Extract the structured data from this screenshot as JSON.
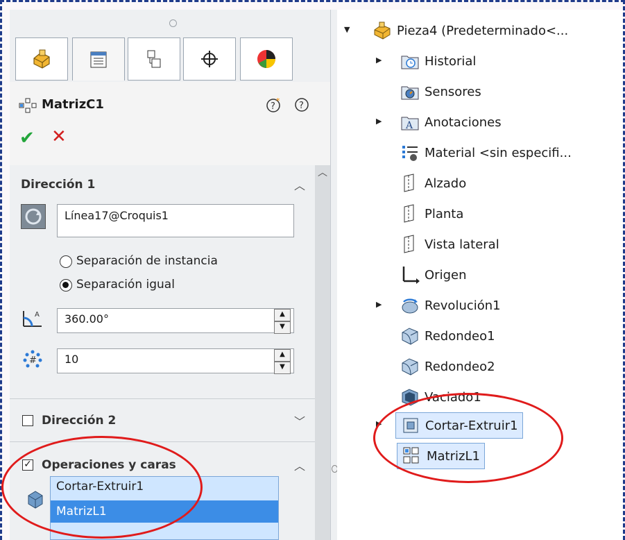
{
  "property_manager": {
    "tabs": [
      "feature-manager",
      "property-manager",
      "configuration-manager",
      "dimxpert-manager",
      "display-manager"
    ],
    "title": "MatrizC1",
    "direction1": {
      "title": "Dirección 1",
      "axis_value": "Línea17@Croquis1",
      "radio_options": [
        "Separación de instancia",
        "Separación igual"
      ],
      "selected_option": "Separación igual",
      "angle": "360.00°",
      "instances": "10"
    },
    "direction2": {
      "title": "Dirección 2",
      "checked": false
    },
    "features": {
      "title": "Operaciones y caras",
      "checked": true,
      "items": [
        "Cortar-Extruir1",
        "MatrizL1"
      ],
      "selected": "MatrizL1"
    }
  },
  "tree": {
    "root": "Pieza4  (Predeterminado<...",
    "items": [
      {
        "label": "Historial",
        "icon": "history-folder-icon",
        "expand": true
      },
      {
        "label": "Sensores",
        "icon": "sensors-folder-icon",
        "expand": false
      },
      {
        "label": "Anotaciones",
        "icon": "annotations-folder-icon",
        "expand": true
      },
      {
        "label": "Material <sin especifi...",
        "icon": "material-icon",
        "expand": false
      },
      {
        "label": "Alzado",
        "icon": "plane-icon",
        "expand": false
      },
      {
        "label": "Planta",
        "icon": "plane-icon",
        "expand": false
      },
      {
        "label": "Vista lateral",
        "icon": "plane-icon",
        "expand": false
      },
      {
        "label": "Origen",
        "icon": "origin-icon",
        "expand": false
      },
      {
        "label": "Revolución1",
        "icon": "revolve-icon",
        "expand": true
      },
      {
        "label": "Redondeo1",
        "icon": "fillet-icon",
        "expand": false
      },
      {
        "label": "Redondeo2",
        "icon": "fillet-icon",
        "expand": false
      },
      {
        "label": "Vaciado1",
        "icon": "shell-icon",
        "expand": false
      },
      {
        "label": "Cortar-Extruir1",
        "icon": "cut-extrude-icon",
        "expand": true
      },
      {
        "label": "MatrizL1",
        "icon": "linear-pattern-icon",
        "expand": false
      }
    ]
  },
  "colors": {
    "accent": "#3c8de6",
    "annotation": "#e01b1b",
    "ok": "#22a53a",
    "cancel": "#d21f1f"
  }
}
